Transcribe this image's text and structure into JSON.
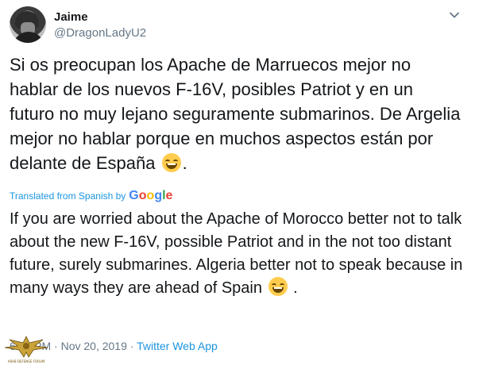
{
  "author": {
    "name": "Jaime",
    "handle": "@DragonLadyU2",
    "avatar_icon": "avatar-soldier-helmet"
  },
  "menu_icon": "chevron-down-icon",
  "tweet": {
    "original_text": "Si os preocupan los Apache de Marruecos mejor no hablar de los nuevos F-16V, posibles Patriot y en un futuro no muy lejano seguramente submarinos. De Argelia mejor no hablar porque en muchos aspectos están por delante de España",
    "original_suffix": ".",
    "emoji_icon": "grinning-face-emoji",
    "translation_label": "Translated from Spanish by",
    "translation_provider": "Google",
    "translated_text": "If you are worried about the Apache of Morocco better not to talk about the new F-16V, possible Patriot and in the not too distant future, surely submarines. Algeria better not to speak because in many ways they are ahead of Spain",
    "translated_suffix": "."
  },
  "meta": {
    "time": "6:26 PM",
    "separator": "·",
    "date": "Nov 20, 2019",
    "source": "Twitter Web App"
  },
  "watermark": {
    "text": "ARAB DEFENSE FORUM"
  },
  "colors": {
    "link": "#1b95e0",
    "secondary_text": "#657786",
    "primary_text": "#14171a"
  }
}
